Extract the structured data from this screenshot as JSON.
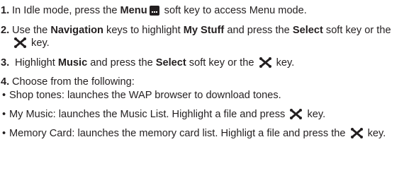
{
  "steps": [
    {
      "num": "1.",
      "t1": "In Idle mode, press the ",
      "b1": "Menu",
      "t2": " soft key to access Menu mode."
    },
    {
      "num": "2.",
      "t1": "Use the ",
      "b1": "Navigation",
      "t2": " keys to highlight ",
      "b2": "My Stuff",
      "t3": " and press the ",
      "b3": "Select",
      "t4": " soft key or the ",
      "t5": " key."
    },
    {
      "num": "3.",
      "t1": "Highlight ",
      "b1": "Music",
      "t2": " and press the ",
      "b2": "Select",
      "t3": " soft key or the ",
      "t4": " key."
    },
    {
      "num": "4.",
      "t1": "Choose from the following:"
    }
  ],
  "bullet_char": "•",
  "bullets": [
    {
      "t1": "Shop tones: launches the WAP browser to download tones."
    },
    {
      "t1": "My Music: launches the Music List. Highlight a file and press ",
      "t2": " key."
    },
    {
      "t1": "Memory Card: launches the memory card list. Highligt a file and press the ",
      "t2": " key."
    }
  ],
  "icons": {
    "menu_key": "menu-softkey-icon",
    "select_key": "x-select-key-icon"
  },
  "colors": {
    "text": "#231f20",
    "icon": "#231f20"
  }
}
